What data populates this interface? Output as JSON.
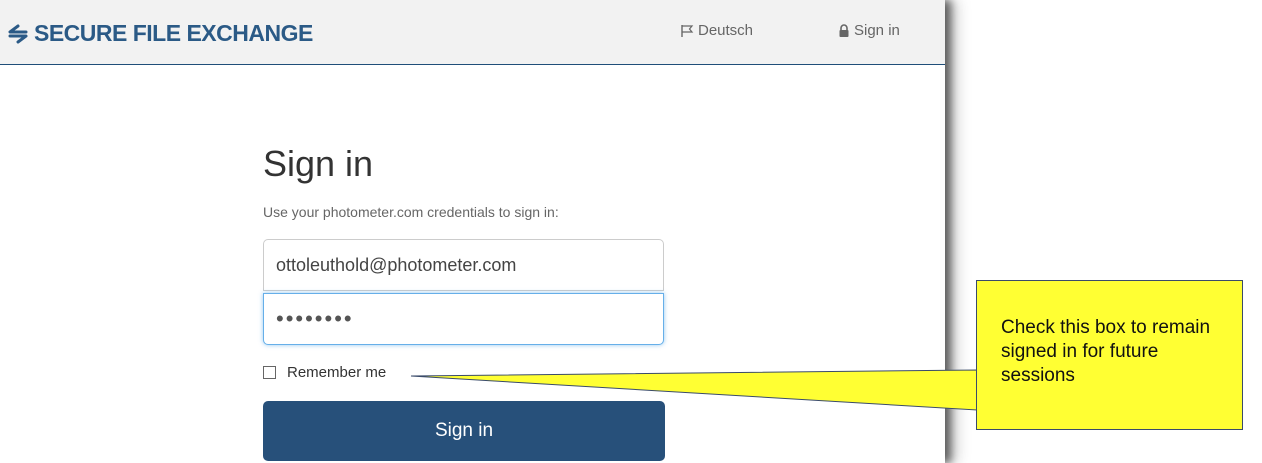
{
  "header": {
    "brand": "SECURE FILE EXCHANGE",
    "language_link": "Deutsch",
    "signin_link": "Sign in"
  },
  "form": {
    "title": "Sign in",
    "subtitle": "Use your photometer.com credentials to sign in:",
    "email_value": "ottoleuthold@photometer.com",
    "password_value": "••••••••",
    "remember_label": "Remember me",
    "remember_checked": false,
    "submit_label": "Sign in"
  },
  "callout": {
    "text": "Check this box to remain signed in for future sessions"
  },
  "colors": {
    "brand": "#2b5a86",
    "button": "#27507a",
    "callout_fill": "#ffff33"
  }
}
